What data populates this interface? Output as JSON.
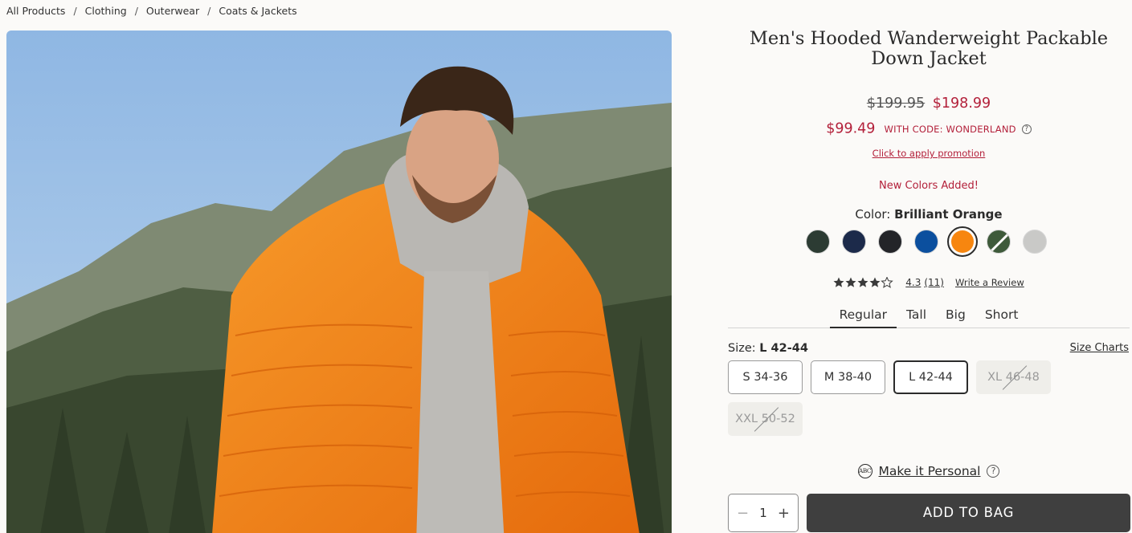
{
  "breadcrumb": [
    "All Products",
    "Clothing",
    "Outerwear",
    "Coats & Jackets"
  ],
  "breadcrumb_sep": "/",
  "product": {
    "title": "Men's Hooded Wanderweight Packable Down Jacket",
    "price_original": "$199.95",
    "price_sale": "$198.99",
    "promo_price": "$99.49",
    "promo_code_text": "WITH CODE: WONDERLAND",
    "apply_promo_link": "Click to apply promotion",
    "new_colors_note": "New Colors Added!",
    "color_prefix": "Color:",
    "color_selected": "Brilliant Orange",
    "swatches": [
      {
        "color": "#2c3b33",
        "selected": false
      },
      {
        "color": "#1c2a4a",
        "selected": false
      },
      {
        "color": "#232428",
        "selected": false
      },
      {
        "color": "#0b4f9e",
        "selected": false
      },
      {
        "color": "#f7860f",
        "selected": true
      },
      {
        "color": "#3e5a3a",
        "selected": false,
        "split": true
      },
      {
        "color": "#c9c9c7",
        "selected": false
      }
    ],
    "rating": "4.3",
    "review_count": "(11)",
    "write_review": "Write a Review",
    "fit_tabs": [
      "Regular",
      "Tall",
      "Big",
      "Short"
    ],
    "size_prefix": "Size:",
    "size_selected": "L 42-44",
    "size_charts": "Size Charts",
    "sizes": [
      "S 34-36",
      "M 38-40",
      "L 42-44",
      "XL 46-48",
      "XXL 50-52"
    ],
    "personalize": "Make it Personal",
    "monogram_icon": "ABC",
    "quantity": "1",
    "qty_minus": "−",
    "qty_plus": "+",
    "add_to_bag": "ADD TO BAG"
  },
  "icons": {
    "help": "?",
    "star": "star-icon"
  }
}
